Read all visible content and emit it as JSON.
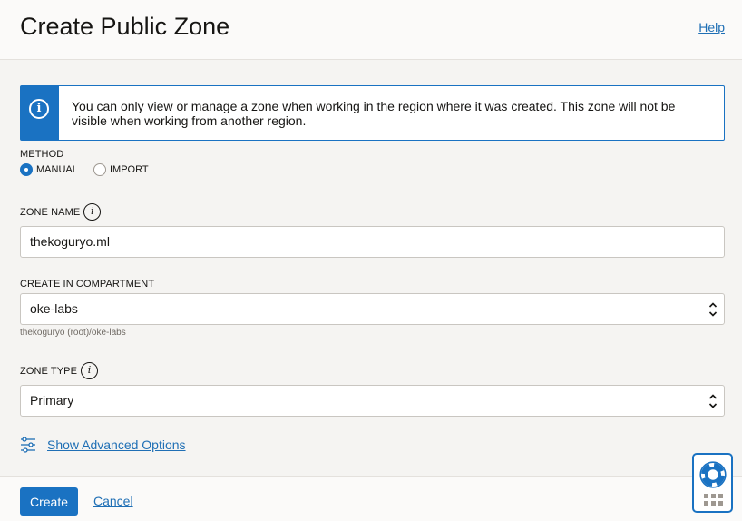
{
  "header": {
    "title": "Create Public Zone",
    "help_label": "Help"
  },
  "info_banner": {
    "icon": "info-icon",
    "text": "You can only view or manage a zone when working in the region where it was created. This zone will not be visible when working from another region."
  },
  "method": {
    "label": "METHOD",
    "options": [
      {
        "label": "MANUAL",
        "selected": true
      },
      {
        "label": "IMPORT",
        "selected": false
      }
    ]
  },
  "zone_name": {
    "label": "ZONE NAME",
    "value": "thekoguryo.ml"
  },
  "compartment": {
    "label": "CREATE IN COMPARTMENT",
    "value": "oke-labs",
    "hint": "thekoguryo (root)/oke-labs"
  },
  "zone_type": {
    "label": "ZONE TYPE",
    "value": "Primary"
  },
  "advanced": {
    "label": "Show Advanced Options",
    "icon": "sliders-icon"
  },
  "footer": {
    "create_label": "Create",
    "cancel_label": "Cancel"
  },
  "colors": {
    "accent": "#1a72c2",
    "link": "#1f6fb5",
    "background": "#f5f4f2"
  }
}
